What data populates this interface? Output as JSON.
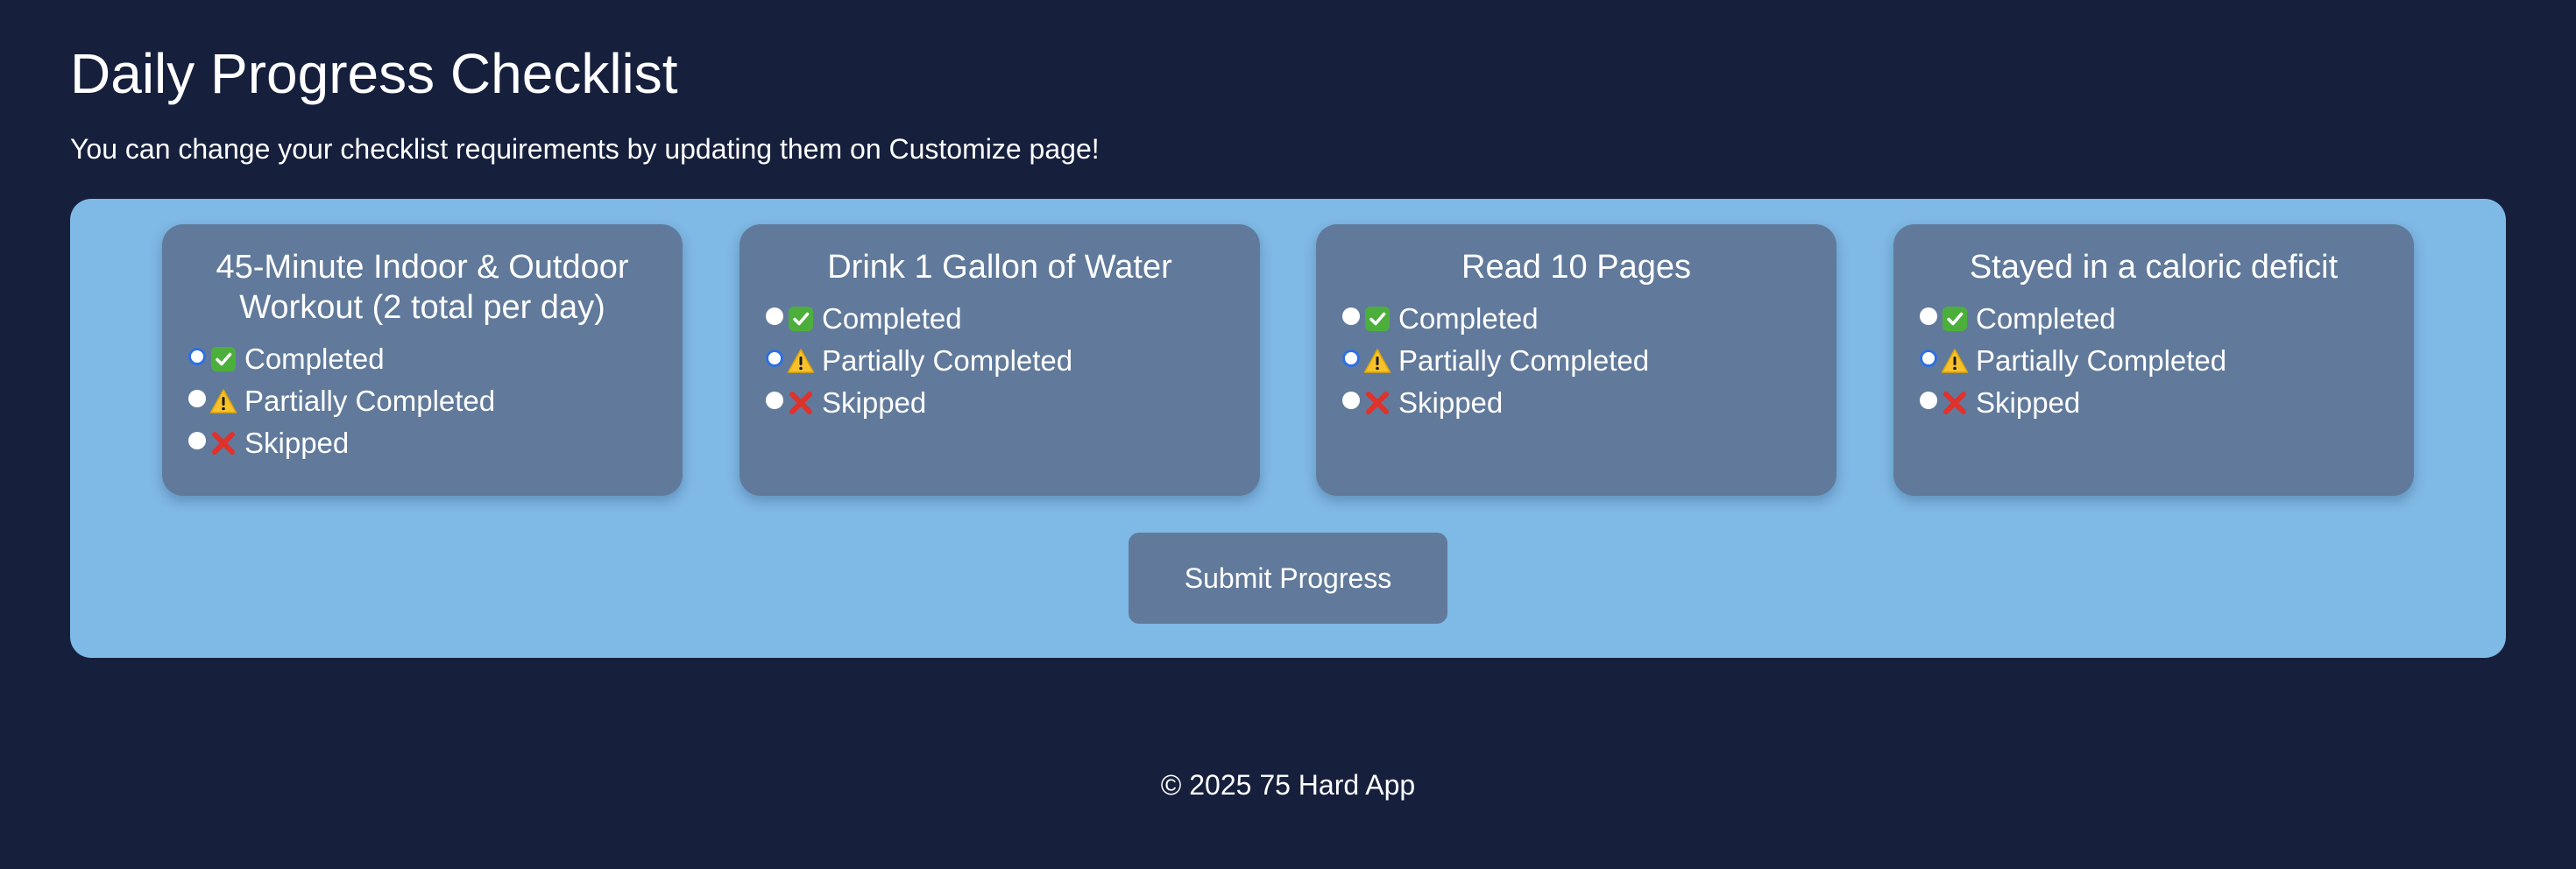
{
  "page": {
    "title": "Daily Progress Checklist",
    "subtitle": "You can change your checklist requirements by updating them on Customize page!"
  },
  "colors": {
    "background": "#16203d",
    "panel": "#7fb9e5",
    "card": "#617a9b",
    "radio_checked": "#2f6fe0"
  },
  "option_icons": {
    "completed": "check-mark-icon",
    "partial": "warning-icon",
    "skipped": "cross-mark-icon"
  },
  "tasks": [
    {
      "title": "45-Minute Indoor & Outdoor Workout (2 total per day)",
      "selected": "completed",
      "options": {
        "completed": "Completed",
        "partial": "Partially Completed",
        "skipped": "Skipped"
      }
    },
    {
      "title": "Drink 1 Gallon of Water",
      "selected": "partial",
      "options": {
        "completed": "Completed",
        "partial": "Partially Completed",
        "skipped": "Skipped"
      }
    },
    {
      "title": "Read 10 Pages",
      "selected": "partial",
      "options": {
        "completed": "Completed",
        "partial": "Partially Completed",
        "skipped": "Skipped"
      }
    },
    {
      "title": "Stayed in a caloric deficit",
      "selected": "partial",
      "options": {
        "completed": "Completed",
        "partial": "Partially Completed",
        "skipped": "Skipped"
      }
    }
  ],
  "submit_label": "Submit Progress",
  "footer": "© 2025 75 Hard App"
}
